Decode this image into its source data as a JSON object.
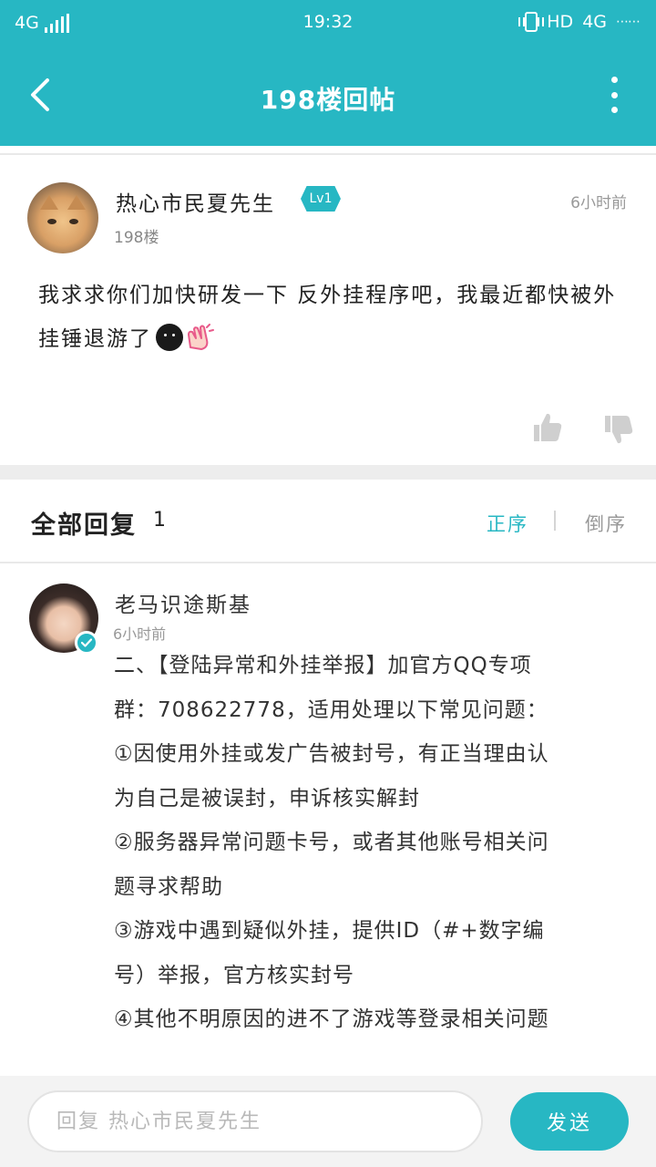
{
  "status_bar": {
    "network_left": "4G",
    "time": "19:32",
    "hd": "HD",
    "network_right": "4G"
  },
  "header": {
    "title": "198楼回帖"
  },
  "post": {
    "author": "热心市民夏先生",
    "level": "Lv1",
    "time": "6小时前",
    "floor": "198楼",
    "body": "我求求你们加快研发一下 反外挂程序吧，我最近都快被外挂锤退游了"
  },
  "replies": {
    "title": "全部回复",
    "count": "1",
    "sort_asc": "正序",
    "sort_desc": "倒序",
    "items": [
      {
        "author": "老马识途斯基",
        "time": "6小时前",
        "lines": [
          "二、【登陆异常和外挂举报】加官方QQ专项",
          "群：708622778，适用处理以下常见问题：",
          "①因使用外挂或发广告被封号，有正当理由认",
          "为自己是被误封，申诉核实解封",
          "②服务器异常问题卡号，或者其他账号相关问",
          "题寻求帮助",
          "③游戏中遇到疑似外挂，提供ID（#+数字编",
          "号）举报，官方核实封号",
          "④其他不明原因的进不了游戏等登录相关问题"
        ]
      }
    ]
  },
  "footer": {
    "input_placeholder": "回复 热心市民夏先生",
    "send_label": "发送"
  },
  "colors": {
    "accent": "#27b7c3",
    "muted_text": "#999999",
    "section_gap": "#ededed"
  },
  "icons": [
    "back-arrow-icon",
    "more-vert-icon",
    "vibrate-icon",
    "thumbs-up-icon",
    "thumbs-down-icon",
    "verified-check-icon",
    "dark-face-emoji",
    "clapping-hands-emoji"
  ]
}
